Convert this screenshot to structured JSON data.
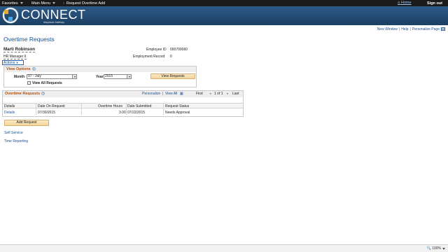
{
  "topnav": {
    "favorites": "Favorites",
    "main_menu": "Main Menu",
    "breadcrumb": "Request Overtime Add",
    "home": "Home",
    "sign_out": "Sign out"
  },
  "banner": {
    "logo_text": "CONNECT",
    "logo_sub": "Maryland Judiciary"
  },
  "utility_links": {
    "new_window": "New Window",
    "help": "Help",
    "personalize_page": "Personalize Page"
  },
  "page": {
    "title": "Overtime Requests",
    "employee_name": "Marti Robinson",
    "employee_role": "HR Manager II",
    "employee_id_label": "Employee ID",
    "employee_id": "000700060",
    "employment_record_label": "Employment Record",
    "employment_record": "0",
    "actions": "Actions"
  },
  "view_options": {
    "title": "View Options",
    "month_label": "Month",
    "month_value": "07 - July",
    "year_label": "Year",
    "year_value": "2015",
    "view_button": "View Requests",
    "view_all_label": "View All Requests"
  },
  "grid": {
    "title": "Overtime Requests",
    "personalize": "Personalize",
    "view_all": "View All",
    "first": "First",
    "page_info": "1 of 1",
    "last": "Last",
    "columns": [
      "Details",
      "Date On Request",
      "Overtime Hours",
      "Date Submitted",
      "Request Status"
    ],
    "rows": [
      {
        "details": "Details",
        "date_on_request": "07/30/2015",
        "overtime_hours": "3.00",
        "date_submitted": "07/22/2015",
        "status": "Needs Approval"
      }
    ]
  },
  "add_button": "Add Request",
  "footer_links": {
    "self_service": "Self Service",
    "time_reporting": "Time Reporting"
  },
  "status_bar": {
    "zoom": "100%"
  },
  "colors": {
    "banner": "#1c3f63",
    "link": "#1b4f8a",
    "section_title": "#b84a00",
    "button": "#f3d49a"
  }
}
